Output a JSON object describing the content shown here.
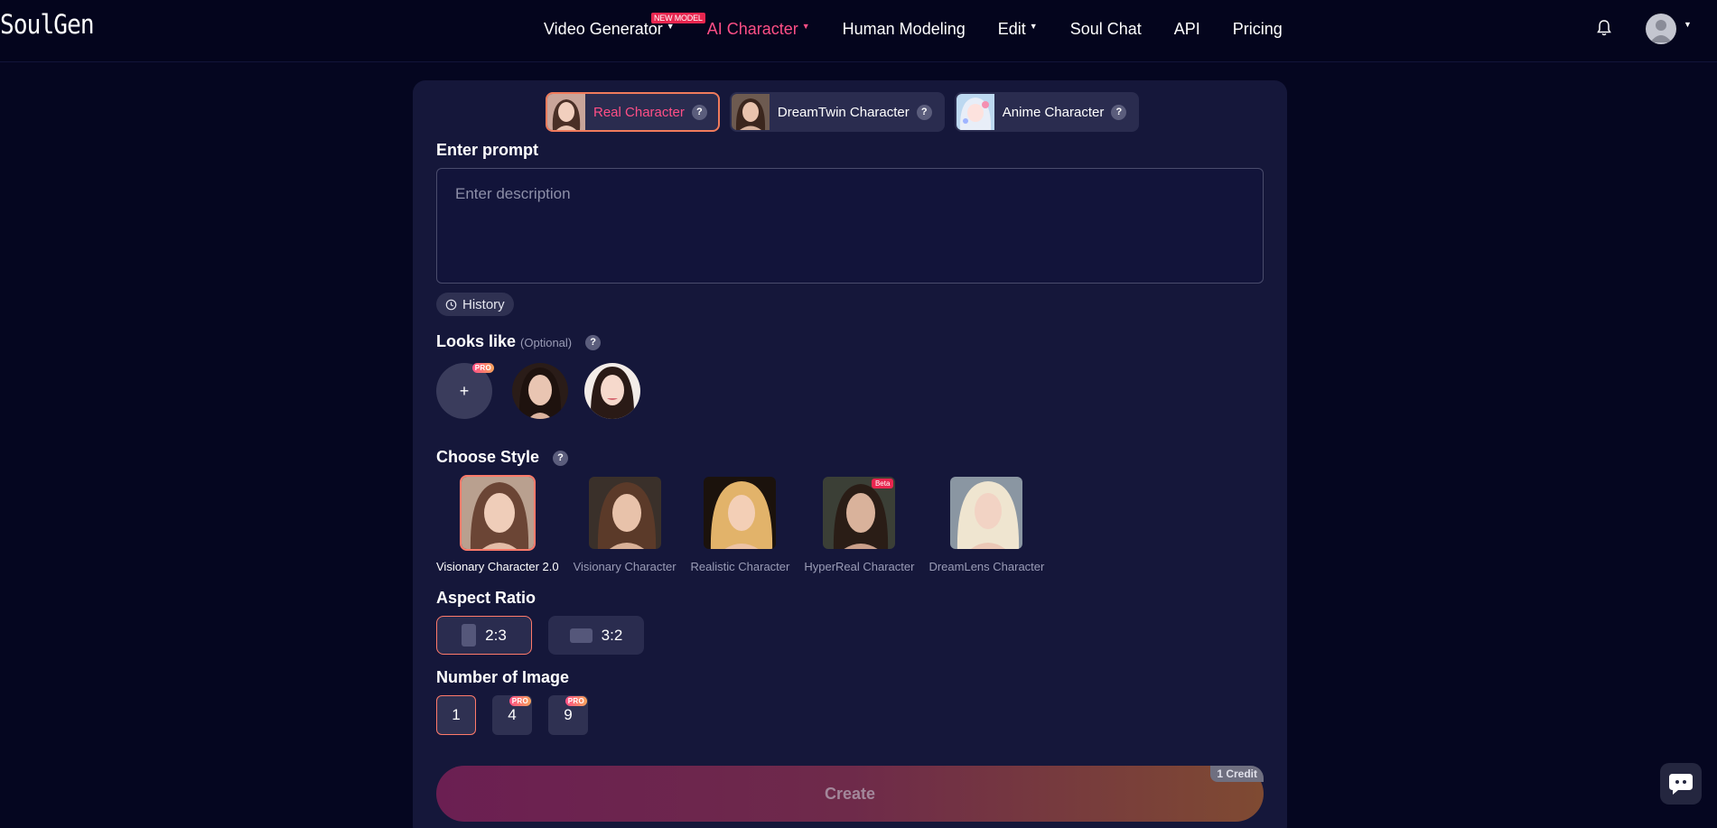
{
  "header": {
    "logo": "SoulGen",
    "nav": [
      {
        "label": "Video Generator",
        "caret": true,
        "badge": "NEW MODEL",
        "active": false
      },
      {
        "label": "AI Character",
        "caret": true,
        "active": true
      },
      {
        "label": "Human Modeling",
        "caret": false,
        "active": false
      },
      {
        "label": "Edit",
        "caret": true,
        "active": false
      },
      {
        "label": "Soul Chat",
        "caret": false,
        "active": false
      },
      {
        "label": "API",
        "caret": false,
        "active": false
      },
      {
        "label": "Pricing",
        "caret": false,
        "active": false
      }
    ],
    "caret_glyph": "▼",
    "icons": {
      "bell": "bell-icon",
      "avatar": "user-avatar-icon"
    }
  },
  "character_tabs": [
    {
      "label": "Real Character",
      "help": "?",
      "active": true
    },
    {
      "label": "DreamTwin Character",
      "help": "?",
      "active": false
    },
    {
      "label": "Anime Character",
      "help": "?",
      "active": false
    }
  ],
  "prompt": {
    "label": "Enter prompt",
    "placeholder": "Enter description",
    "value": ""
  },
  "history": {
    "label": "History"
  },
  "looks_like": {
    "label": "Looks like",
    "optional": "(Optional)",
    "help": "?",
    "add_glyph": "+",
    "pro_badge": "PRO"
  },
  "choose_style": {
    "label": "Choose Style",
    "help": "?",
    "items": [
      {
        "label": "Visionary Character 2.0",
        "active": true,
        "badge": ""
      },
      {
        "label": "Visionary Character",
        "active": false,
        "badge": ""
      },
      {
        "label": "Realistic Character",
        "active": false,
        "badge": ""
      },
      {
        "label": "HyperReal Character",
        "active": false,
        "badge": "Beta"
      },
      {
        "label": "DreamLens Character",
        "active": false,
        "badge": ""
      }
    ]
  },
  "aspect_ratio": {
    "label": "Aspect Ratio",
    "options": [
      {
        "label": "2:3",
        "active": true
      },
      {
        "label": "3:2",
        "active": false
      }
    ]
  },
  "number_of_image": {
    "label": "Number of Image",
    "options": [
      {
        "label": "1",
        "active": true,
        "pro": false
      },
      {
        "label": "4",
        "active": false,
        "pro": true
      },
      {
        "label": "9",
        "active": false,
        "pro": true
      }
    ],
    "pro_badge": "PRO"
  },
  "create": {
    "label": "Create",
    "credit": "1 Credit"
  },
  "colors": {
    "background": "#050620",
    "panel": "#15173a",
    "accent_pink": "#ff4f86",
    "accent_orange": "#f6a45c",
    "badge_red": "#e8264f"
  }
}
